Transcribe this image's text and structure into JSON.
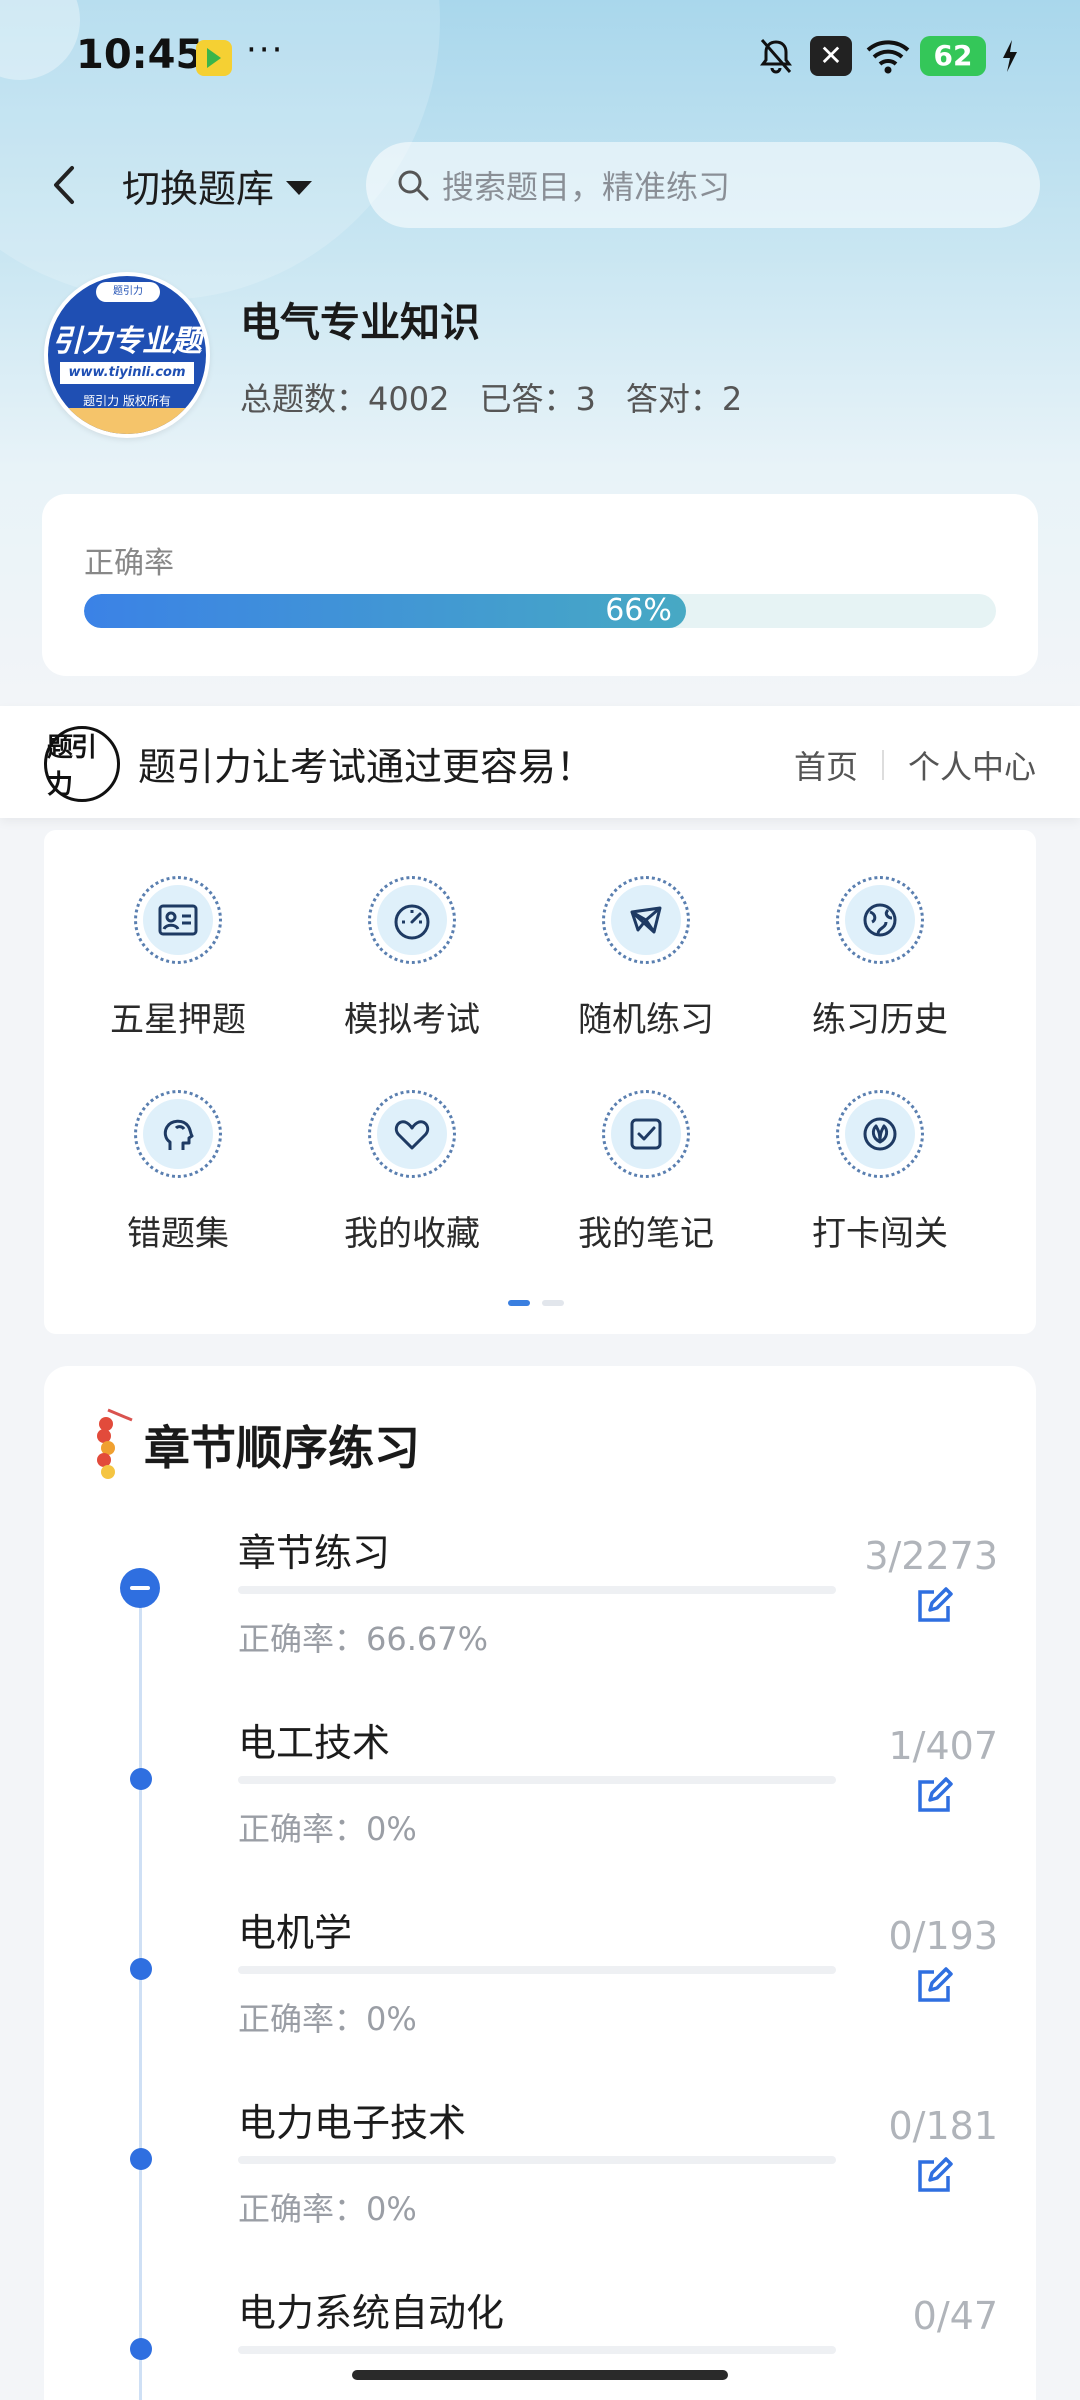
{
  "status_bar": {
    "time": "10:45",
    "dots": "···",
    "battery": "62",
    "x_badge": "✕"
  },
  "topbar": {
    "switch_label": "切换题库",
    "search_placeholder": "搜索题目，精准练习"
  },
  "bank": {
    "logo_tag": "题引力",
    "logo_text": "引力专业题",
    "logo_url": "www.tiyinli.com",
    "logo_rights": "题引力 版权所有",
    "title": "电气专业知识",
    "total": "总题数：4002",
    "answered": "已答：3",
    "correct": "答对：2"
  },
  "accuracy": {
    "label": "正确率",
    "value_text": "66%",
    "percent": 66
  },
  "banner": {
    "logo_text": "题引力",
    "slogan": "题引力让考试通过更容易！",
    "home": "首页",
    "profile": "个人中心"
  },
  "features": [
    {
      "label": "五星押题",
      "icon": "id-card-icon"
    },
    {
      "label": "模拟考试",
      "icon": "gauge-icon"
    },
    {
      "label": "随机练习",
      "icon": "network-icon"
    },
    {
      "label": "练习历史",
      "icon": "globe-icon"
    },
    {
      "label": "错题集",
      "icon": "head-icon"
    },
    {
      "label": "我的收藏",
      "icon": "heart-icon"
    },
    {
      "label": "我的笔记",
      "icon": "checklist-icon"
    },
    {
      "label": "打卡闯关",
      "icon": "leaf-icon"
    }
  ],
  "pager": {
    "pages": 2,
    "active": 0
  },
  "chapters": {
    "title": "章节顺序练习",
    "items": [
      {
        "name": "章节练习",
        "rate": "正确率：66.67%",
        "count": "3/2273"
      },
      {
        "name": "电工技术",
        "rate": "正确率：0%",
        "count": "1/407"
      },
      {
        "name": "电机学",
        "rate": "正确率：0%",
        "count": "0/193"
      },
      {
        "name": "电力电子技术",
        "rate": "正确率：0%",
        "count": "0/181"
      },
      {
        "name": "电力系统自动化",
        "rate": "",
        "count": "0/47"
      }
    ]
  },
  "colors": {
    "accent": "#2f6fe0",
    "bar_end": "#47a9c4"
  }
}
